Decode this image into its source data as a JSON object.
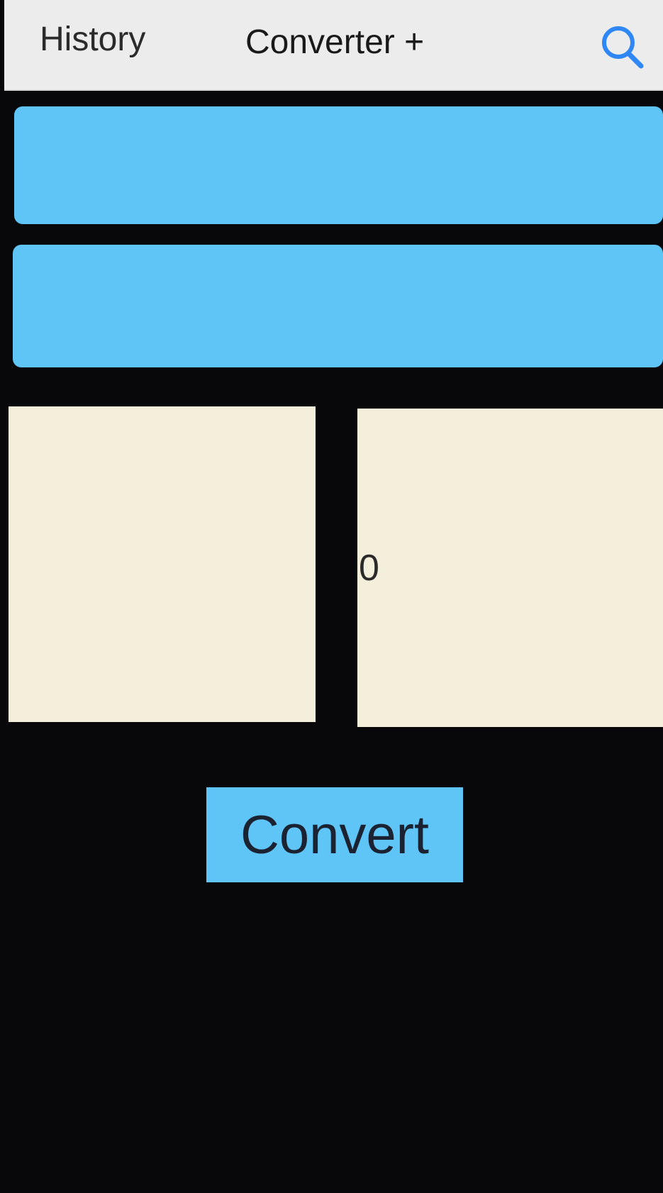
{
  "nav": {
    "history_label": "History",
    "title": "Converter +",
    "search_icon": "search-icon",
    "accent_color": "#2f86f5"
  },
  "pickers": {
    "from_label": "",
    "to_label": "",
    "color": "#5ec5f6"
  },
  "input": {
    "value": "",
    "placeholder": ""
  },
  "output": {
    "value": "0"
  },
  "convert_button": {
    "label": "Convert"
  }
}
